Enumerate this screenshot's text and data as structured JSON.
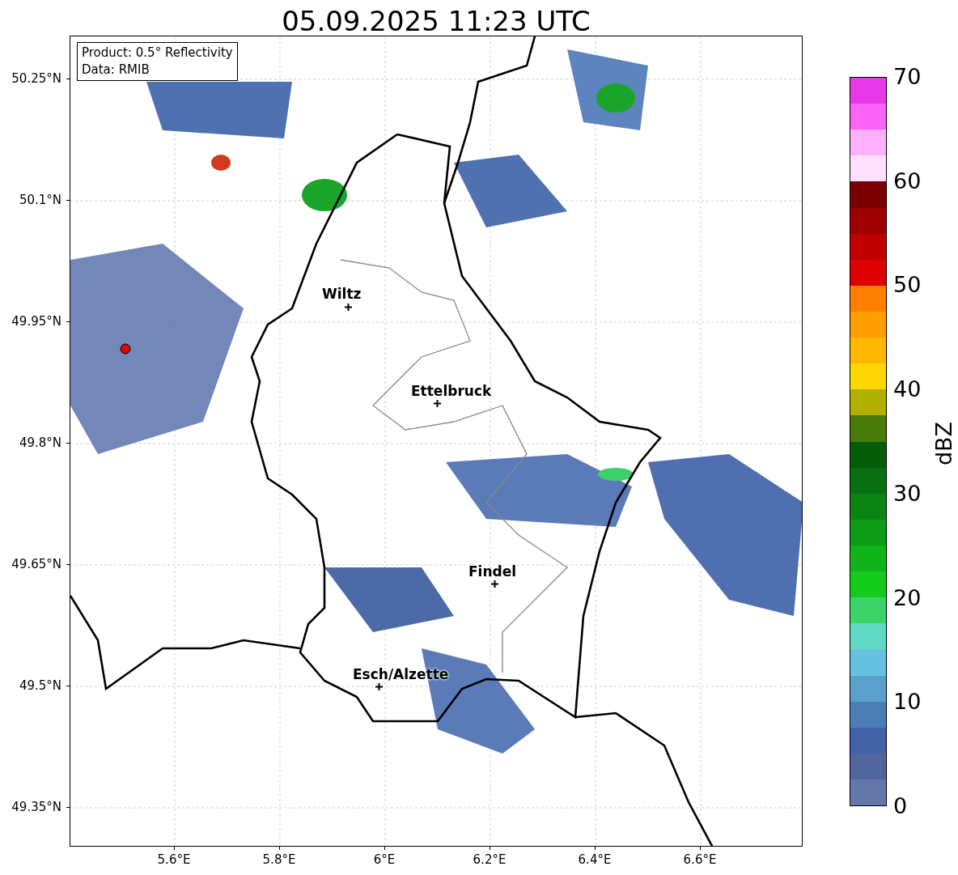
{
  "title": "05.09.2025 11:23 UTC",
  "map": {
    "info_box": [
      "Product: 0.5° Reflectivity",
      "Data: RMIB"
    ],
    "places": [
      {
        "name": "Wiltz"
      },
      {
        "name": "Ettelbruck"
      },
      {
        "name": "Findel"
      },
      {
        "name": "Esch/Alzette"
      }
    ]
  },
  "y_axis": {
    "ticks": [
      "50.25°N",
      "50.1°N",
      "49.95°N",
      "49.8°N",
      "49.65°N",
      "49.5°N",
      "49.35°N"
    ]
  },
  "x_axis": {
    "ticks": [
      "5.6°E",
      "5.8°E",
      "6°E",
      "6.2°E",
      "6.4°E",
      "6.6°E"
    ]
  },
  "colorbar": {
    "label": "dBZ",
    "ticks": [
      "70",
      "60",
      "50",
      "40",
      "30",
      "20",
      "10",
      "0"
    ],
    "segments": [
      {
        "color": "#e838ea"
      },
      {
        "color": "#f963f6"
      },
      {
        "color": "#fdb0fc"
      },
      {
        "color": "#ffe0ff"
      },
      {
        "color": "#7a0000"
      },
      {
        "color": "#9e0000"
      },
      {
        "color": "#c00000"
      },
      {
        "color": "#e00000"
      },
      {
        "color": "#ff8000"
      },
      {
        "color": "#ff9f00"
      },
      {
        "color": "#ffb800"
      },
      {
        "color": "#ffd700"
      },
      {
        "color": "#b0b000"
      },
      {
        "color": "#487b0a"
      },
      {
        "color": "#055d0a"
      },
      {
        "color": "#087010"
      },
      {
        "color": "#0b8414"
      },
      {
        "color": "#0e9c14"
      },
      {
        "color": "#10b41a"
      },
      {
        "color": "#12cb1a"
      },
      {
        "color": "#3bd46a"
      },
      {
        "color": "#5fd8c4"
      },
      {
        "color": "#66c1e0"
      },
      {
        "color": "#5aa0cc"
      },
      {
        "color": "#4d7db5"
      },
      {
        "color": "#4462a8"
      },
      {
        "color": "#52669e"
      },
      {
        "color": "#6378a8"
      }
    ]
  }
}
